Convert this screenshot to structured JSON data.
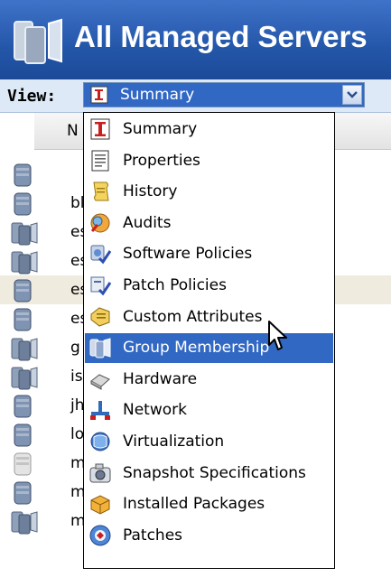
{
  "window": {
    "title": "All Managed Servers"
  },
  "view": {
    "label": "View:",
    "selected": "Summary"
  },
  "table": {
    "header_fragment": "N",
    "rows": [
      "",
      "bl",
      "es",
      "es",
      "es",
      "es",
      "g",
      "is",
      "jh",
      "lo",
      "m",
      "m",
      "m"
    ]
  },
  "dropdown": {
    "options": [
      {
        "label": "Summary",
        "icon": "summary-icon"
      },
      {
        "label": "Properties",
        "icon": "properties-icon"
      },
      {
        "label": "History",
        "icon": "history-icon"
      },
      {
        "label": "Audits",
        "icon": "audits-icon"
      },
      {
        "label": "Software Policies",
        "icon": "software-policies-icon"
      },
      {
        "label": "Patch Policies",
        "icon": "patch-policies-icon"
      },
      {
        "label": "Custom Attributes",
        "icon": "custom-attributes-icon"
      },
      {
        "label": "Group Membership",
        "icon": "group-membership-icon"
      },
      {
        "label": "Hardware",
        "icon": "hardware-icon"
      },
      {
        "label": "Network",
        "icon": "network-icon"
      },
      {
        "label": "Virtualization",
        "icon": "virtualization-icon"
      },
      {
        "label": "Snapshot Specifications",
        "icon": "snapshot-specifications-icon"
      },
      {
        "label": "Installed Packages",
        "icon": "installed-packages-icon"
      },
      {
        "label": "Patches",
        "icon": "patches-icon"
      }
    ],
    "highlighted": "Group Membership"
  },
  "colors": {
    "title_bar": "#2456a9",
    "selection": "#3168c4",
    "view_bar": "#dde9f6"
  }
}
